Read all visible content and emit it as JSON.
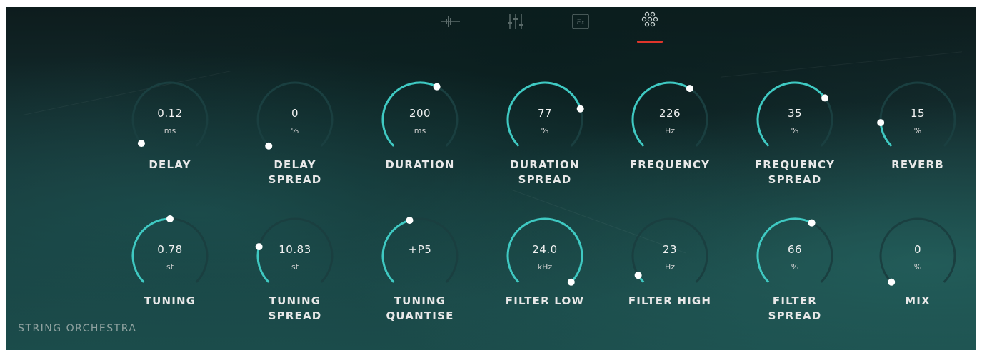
{
  "footer": {
    "title": "STRING ORCHESTRA"
  },
  "nav": [
    {
      "icon": "waveform-icon"
    },
    {
      "icon": "mixer-sliders-icon"
    },
    {
      "icon": "fx-icon",
      "label": "Fx"
    },
    {
      "icon": "dots-grid-icon",
      "active": true
    }
  ],
  "colors": {
    "arc": "#3fc9c2",
    "track": "#1a3f40",
    "accent": "#e0352b"
  },
  "knobs": [
    {
      "value": "0.12",
      "unit": "ms",
      "label": "DELAY",
      "level": 0.02
    },
    {
      "value": "0",
      "unit": "%",
      "label": "DELAY SPREAD",
      "level": 0.0
    },
    {
      "value": "200",
      "unit": "ms",
      "label": "DURATION",
      "level": 0.6
    },
    {
      "value": "77",
      "unit": "%",
      "label": "DURATION SPREAD",
      "level": 0.77
    },
    {
      "value": "226",
      "unit": "Hz",
      "label": "FREQUENCY",
      "level": 0.62
    },
    {
      "value": "35",
      "unit": "%",
      "label": "FREQUENCY SPREAD",
      "level": 0.7
    },
    {
      "value": "15",
      "unit": "%",
      "label": "REVERB",
      "level": 0.15
    },
    {
      "value": "0.78",
      "unit": "st",
      "label": "TUNING",
      "level": 0.5
    },
    {
      "value": "10.83",
      "unit": "st",
      "label": "TUNING SPREAD",
      "level": 0.22
    },
    {
      "value": "+P5",
      "unit": "",
      "label": "TUNING QUANTISE",
      "level": 0.44
    },
    {
      "value": "24.0",
      "unit": "kHz",
      "label": "FILTER LOW",
      "level": 1.0
    },
    {
      "value": "23",
      "unit": "Hz",
      "label": "FILTER HIGH",
      "level": 0.05
    },
    {
      "value": "66",
      "unit": "%",
      "label": "FILTER SPREAD",
      "level": 0.6
    },
    {
      "value": "0",
      "unit": "%",
      "label": "MIX",
      "level": 0.0
    }
  ]
}
